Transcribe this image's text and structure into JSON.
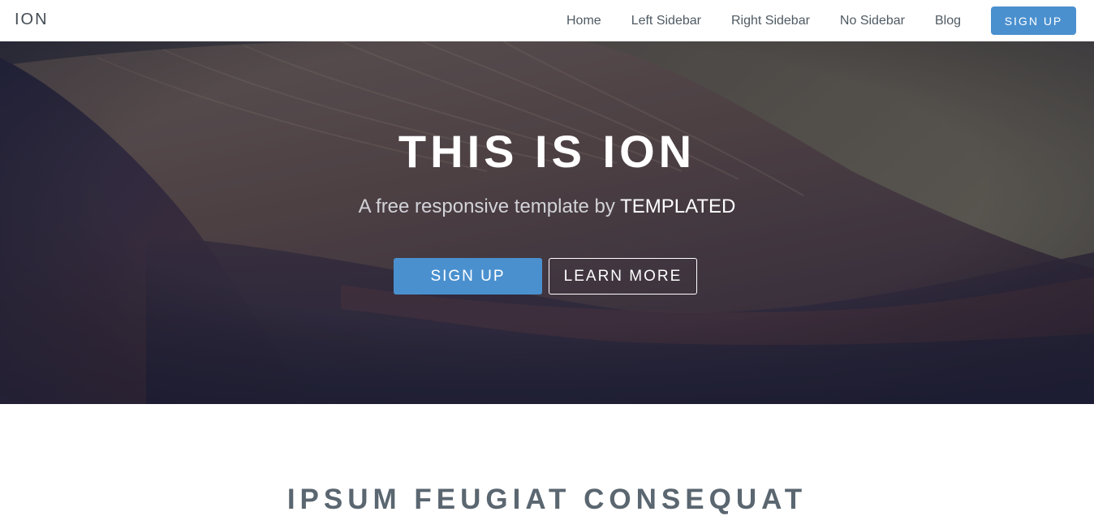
{
  "header": {
    "logo": "ION",
    "nav": [
      "Home",
      "Left Sidebar",
      "Right Sidebar",
      "No Sidebar",
      "Blog"
    ],
    "signup_label": "SIGN UP"
  },
  "banner": {
    "title": "THIS IS ION",
    "subtitle_prefix": "A free responsive template by ",
    "subtitle_brand": "TEMPLATED",
    "primary_button": "SIGN UP",
    "secondary_button": "LEARN MORE"
  },
  "section": {
    "title": "IPSUM FEUGIAT CONSEQUAT"
  },
  "colors": {
    "accent": "#4a90cf",
    "nav_text": "#4f5a63",
    "heading_text": "#5a6670"
  }
}
